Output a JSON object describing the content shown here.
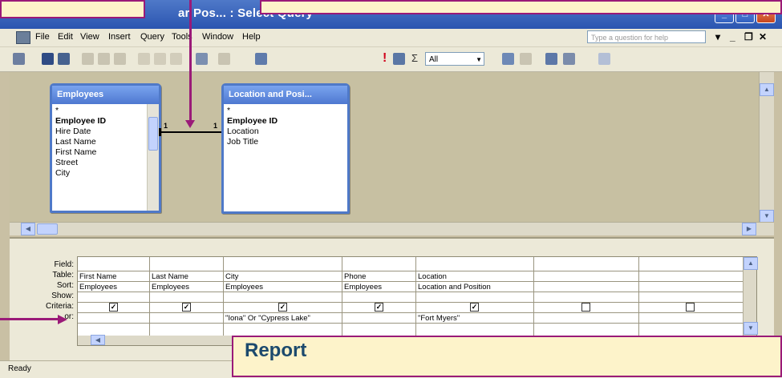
{
  "window": {
    "title": "ar Pos... : Select Query"
  },
  "menubar": {
    "items": [
      "File",
      "Edit",
      "View",
      "Insert",
      "Query",
      "Tools",
      "Window",
      "Help"
    ],
    "question_box": "Type a question for help"
  },
  "toolbar": {
    "top_values": "All"
  },
  "tables": [
    {
      "title": "Employees",
      "fields": [
        "*",
        "Employee ID",
        "Hire Date",
        "Last Name",
        "First Name",
        "Street",
        "City"
      ]
    },
    {
      "title": "Location and Posi...",
      "fields": [
        "*",
        "Employee ID",
        "Location",
        "Job Title"
      ]
    }
  ],
  "relationship": {
    "left": "1",
    "right": "1"
  },
  "design_grid": {
    "row_labels": [
      "Field:",
      "Table:",
      "Sort:",
      "Show:",
      "Criteria:",
      "or:"
    ],
    "columns": [
      {
        "field": "First Name",
        "table": "Employees",
        "show": true,
        "criteria": ""
      },
      {
        "field": "Last Name",
        "table": "Employees",
        "show": true,
        "criteria": ""
      },
      {
        "field": "City",
        "table": "Employees",
        "show": true,
        "criteria": "\"Iona\" Or \"Cypress Lake\""
      },
      {
        "field": "Phone",
        "table": "Employees",
        "show": true,
        "criteria": ""
      },
      {
        "field": "Location",
        "table": "Location and Position",
        "show": true,
        "criteria": "\"Fort Myers\""
      },
      {
        "field": "",
        "table": "",
        "show": false,
        "criteria": ""
      },
      {
        "field": "",
        "table": "",
        "show": false,
        "criteria": ""
      }
    ]
  },
  "status": {
    "text": "Ready"
  },
  "callouts": {
    "bottom_title": "Report"
  },
  "colors": {
    "callout_border": "#9a1a78",
    "callout_fill": "#fdf3ca",
    "callout_text": "#1c4a6d",
    "titlebar": "#2b55b0"
  }
}
